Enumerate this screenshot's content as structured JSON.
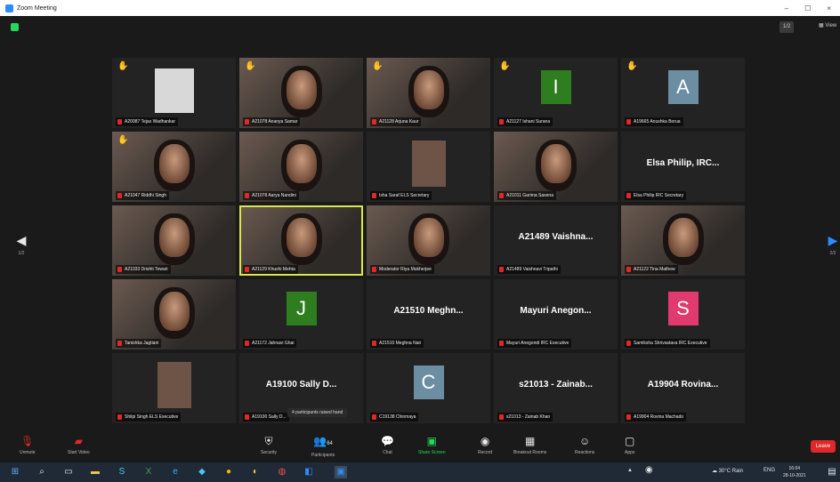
{
  "window": {
    "title": "Zoom Meeting",
    "controls": [
      "–",
      "☐",
      "×"
    ]
  },
  "topbar": {
    "pager": "1/2",
    "view_label": "View"
  },
  "tiles": [
    {
      "caption": "A20087 Tejas Wadhankar",
      "hand": true,
      "kind": "sketch"
    },
    {
      "caption": "A21078 Ananya Samar",
      "hand": true,
      "kind": "video"
    },
    {
      "caption": "A21128 Arjuna Kaur",
      "hand": true,
      "kind": "video"
    },
    {
      "caption": "A21127 Ishani Surana",
      "hand": true,
      "kind": "avatar",
      "letter": "I",
      "color": "#2e7d1e"
    },
    {
      "caption": "A19665 Anushka Borua",
      "hand": true,
      "kind": "avatar",
      "letter": "A",
      "color": "#6c8ea3"
    },
    {
      "caption": "A21047 Riddhi Singh",
      "hand": true,
      "kind": "video"
    },
    {
      "caption": "A21078 Aarya Nandini",
      "hand": false,
      "kind": "video"
    },
    {
      "caption": "Isha Saraf ELS Secretary",
      "hand": false,
      "kind": "pic"
    },
    {
      "caption": "A21011 Garima Saxena",
      "hand": false,
      "kind": "video"
    },
    {
      "caption": "Elsa Philip IRC Secretary",
      "hand": false,
      "kind": "name",
      "name": "Elsa Philip, IRC..."
    },
    {
      "caption": "A21033 Drishti Tewari",
      "hand": false,
      "kind": "video"
    },
    {
      "caption": "A21129 Khushi Mehta",
      "hand": false,
      "kind": "video",
      "active": true
    },
    {
      "caption": "Moderator Riya Mukherjee",
      "hand": false,
      "kind": "video"
    },
    {
      "caption": "A21489 Vaishnavi Tripathi",
      "hand": false,
      "kind": "name",
      "name": "A21489 Vaishna..."
    },
    {
      "caption": "A21122 Tina Mathew",
      "hand": false,
      "kind": "video"
    },
    {
      "caption": "Tanishka Jagtiani",
      "hand": false,
      "kind": "video"
    },
    {
      "caption": "A21172 Jahnavi Ghai",
      "hand": false,
      "kind": "avatar",
      "letter": "J",
      "color": "#2e7d1e"
    },
    {
      "caption": "A21510 Meghna Nair",
      "hand": false,
      "kind": "name",
      "name": "A21510 Meghn..."
    },
    {
      "caption": "Mayuri Anegondi IRC Executive",
      "hand": false,
      "kind": "name",
      "name": "Mayuri Anegon..."
    },
    {
      "caption": "Samiksha Shrivastava IRC Executive",
      "hand": false,
      "kind": "avatar",
      "letter": "S",
      "color": "#e03a6f"
    },
    {
      "caption": "Shilpi Singh ELS Executive",
      "hand": false,
      "kind": "pic"
    },
    {
      "caption": "A19100 Sally D...",
      "hand": false,
      "kind": "name",
      "name": "A19100 Sally D..."
    },
    {
      "caption": "C19138 Chinmaya",
      "hand": false,
      "kind": "avatar",
      "letter": "C",
      "color": "#6c8ea3"
    },
    {
      "caption": "s21013 - Zainab Khan",
      "hand": false,
      "kind": "name",
      "name": "s21013 - Zainab..."
    },
    {
      "caption": "A19904 Rovina Machado",
      "hand": false,
      "kind": "name",
      "name": "A19904 Rovina..."
    }
  ],
  "raised_hand_tip": "4 participants raised hand",
  "nav": {
    "prev_page": "1/2",
    "next_page": "2/2"
  },
  "toolbar": {
    "unmute": "Unmute",
    "start_video": "Start Video",
    "security": "Security",
    "participants": "Participants",
    "participants_count": "64",
    "chat": "Chat",
    "share_screen": "Share Screen",
    "record": "Record",
    "breakout_rooms": "Breakout Rooms",
    "reactions": "Reactions",
    "apps": "Apps",
    "leave": "Leave"
  },
  "taskbar": {
    "weather": "30°C Rain",
    "time": "16:04",
    "date": "28-10-2021",
    "lang": "ENG"
  },
  "colors": {
    "accent_green": "#23d959",
    "leave_red": "#e02828",
    "active_speaker": "#d7e84a"
  }
}
